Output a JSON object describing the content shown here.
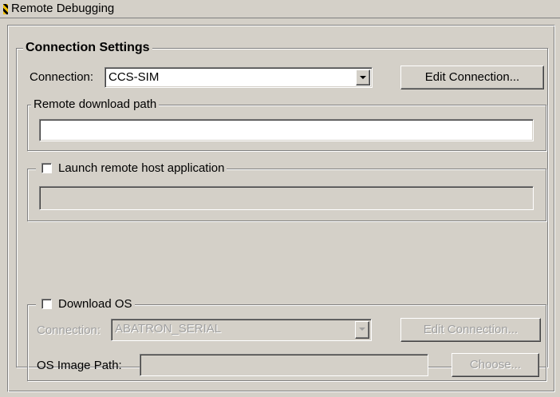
{
  "window": {
    "title": "Remote Debugging"
  },
  "connection_settings": {
    "legend": "Connection Settings",
    "connection_label": "Connection:",
    "connection_value": "CCS-SIM",
    "edit_connection_label": "Edit Connection..."
  },
  "remote_download": {
    "legend": "Remote download path",
    "value": ""
  },
  "launch_remote": {
    "legend": "Launch remote host application",
    "checked": false,
    "value": ""
  },
  "download_os": {
    "legend": "Download OS",
    "checked": false,
    "connection_label": "Connection:",
    "connection_value": "ABATRON_SERIAL",
    "edit_connection_label": "Edit Connection...",
    "os_image_label": "OS Image Path:",
    "os_image_value": "",
    "choose_label": "Choose..."
  }
}
